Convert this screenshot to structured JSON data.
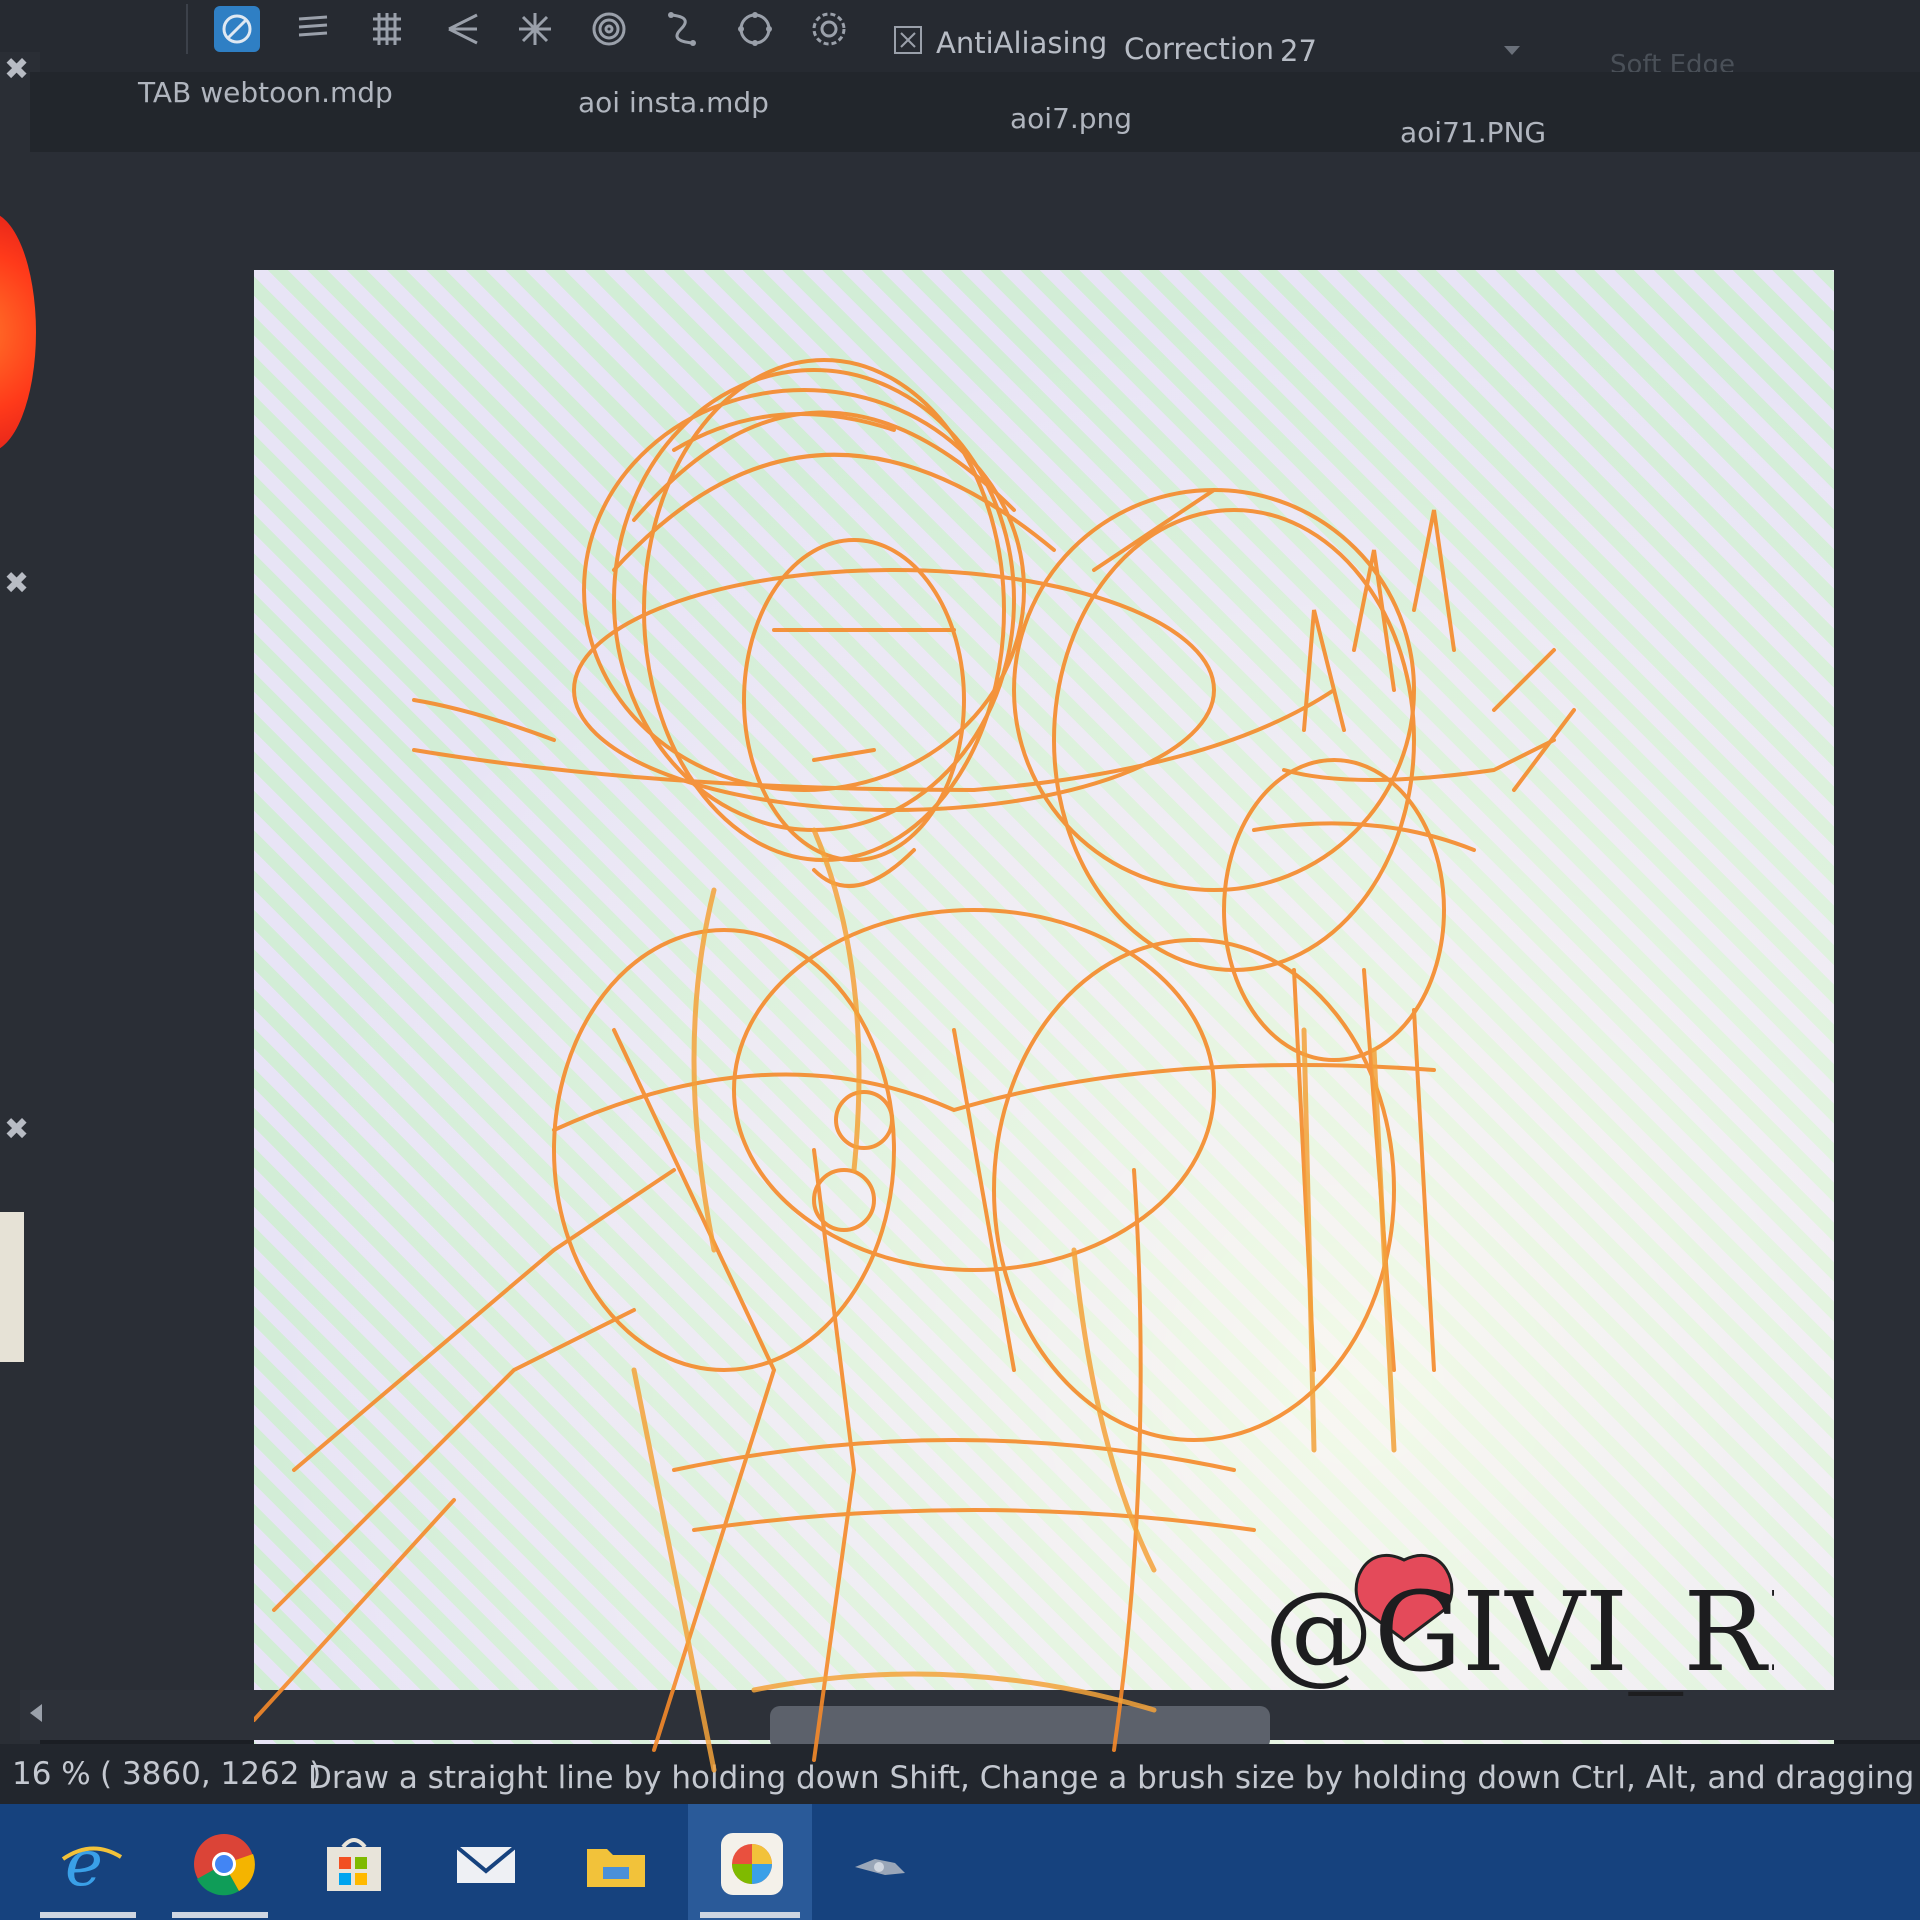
{
  "toolbar": {
    "antialiasing_label": "AntiAliasing",
    "correction_label": "Correction",
    "correction_value": "27",
    "soft_edge_label": "Soft Edge",
    "tools": [
      "snap-off-icon",
      "parallel-snap-icon",
      "grid-snap-icon",
      "perspective-snap-icon",
      "radial-snap-icon",
      "concentric-snap-icon",
      "curve-snap-icon",
      "circle-snap-icon",
      "snap-settings-icon"
    ]
  },
  "tabs": [
    {
      "label": "TAB webtoon.mdp"
    },
    {
      "label": "aoi insta.mdp"
    },
    {
      "label": "aoi7.png"
    },
    {
      "label": "aoi71.PNG"
    }
  ],
  "canvas": {
    "sketch_color": "#f58a2a",
    "signature_text": "@GIVI_REID"
  },
  "status": {
    "zoom": "16 %",
    "coords": "( 3860, 1262 )",
    "hint": "Draw a straight line by holding down Shift, Change a brush size by holding down Ctrl, Alt, and dragging"
  },
  "taskbar": {
    "apps": [
      "internet-explorer-icon",
      "chrome-icon",
      "store-icon",
      "mail-icon",
      "file-explorer-icon",
      "medibang-icon",
      "app-icon"
    ]
  }
}
